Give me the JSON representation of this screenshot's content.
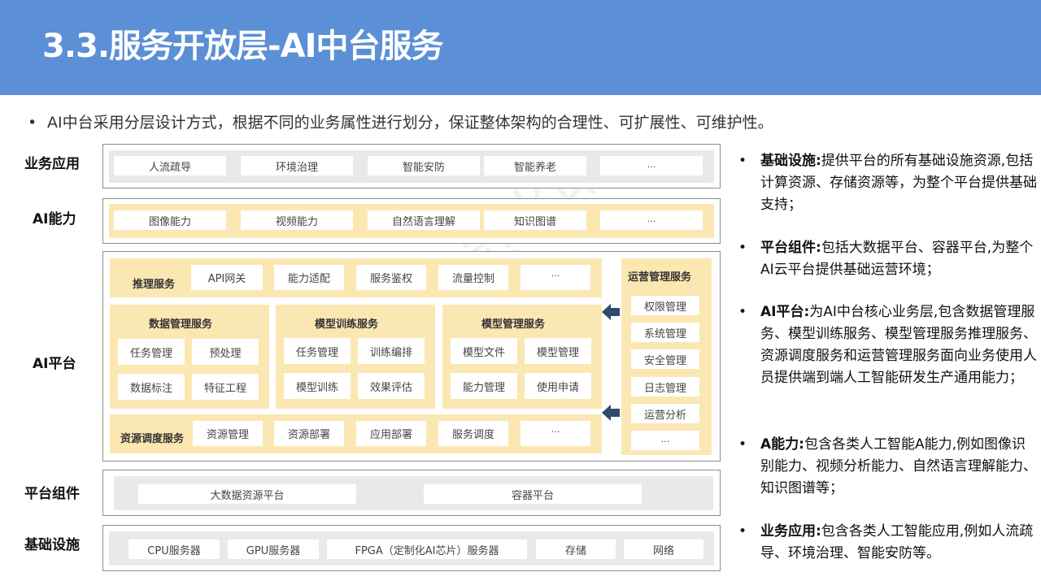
{
  "title": "3.3.服务开放层-AI中台服务",
  "intro": "AI中台采用分层设计方式，根据不同的业务属性进行划分，保证整体架构的合理性、可扩展性、可维护性。",
  "bullet": "•",
  "layers": {
    "business": {
      "label": "业务应用",
      "items": [
        "人流疏导",
        "环境治理",
        "智能安防",
        "智能养老",
        "…"
      ]
    },
    "ability": {
      "label": "AI能力",
      "items": [
        "图像能力",
        "视频能力",
        "自然语言理解",
        "知识图谱",
        "…"
      ]
    },
    "platform": {
      "label": "AI平台",
      "inference": {
        "title": "推理服务",
        "items": [
          "API网关",
          "能力适配",
          "服务鉴权",
          "流量控制",
          "…"
        ]
      },
      "data_mgmt": {
        "title": "数据管理服务",
        "items": [
          "任务管理",
          "预处理",
          "数据标注",
          "特征工程"
        ]
      },
      "training": {
        "title": "模型训练服务",
        "items": [
          "任务管理",
          "训练编排",
          "模型训练",
          "效果评估"
        ]
      },
      "model_mgmt": {
        "title": "模型管理服务",
        "items": [
          "模型文件",
          "模型管理",
          "能力管理",
          "使用申请"
        ]
      },
      "scheduling": {
        "title": "资源调度服务",
        "items": [
          "资源管理",
          "资源部署",
          "应用部署",
          "服务调度",
          "…"
        ]
      },
      "operations": {
        "title": "运营管理服务",
        "items": [
          "权限管理",
          "系统管理",
          "安全管理",
          "日志管理",
          "运营分析",
          "…"
        ]
      }
    },
    "components": {
      "label": "平台组件",
      "items": [
        "大数据资源平台",
        "容器平台"
      ]
    },
    "infrastructure": {
      "label": "基础设施",
      "items": [
        "CPU服务器",
        "GPU服务器",
        "FPGA（定制化AI芯片）服务器",
        "存储",
        "网络"
      ]
    }
  },
  "descriptions": [
    {
      "term": "基础设施:",
      "text": "提供平台的所有基础设施资源,包括计算资源、存储资源等，为整个平台提供基础支持；"
    },
    {
      "term": "平台组件:",
      "text": "包括大数据平台、容器平台,为整个AI云平台提供基础运营环境；"
    },
    {
      "term": "AI平台:",
      "text": "为AI中台核心业务层,包含数据管理服务、模型训练服务、模型管理服务推理服务、资源调度服务和运营管理服务面向业务使用人员提供端到端人工智能研发生产通用能力；"
    },
    {
      "term": "A能力:",
      "text": "包含各类人工智能A能力,例如图像识别能力、视频分析能力、自然语言理解能力、知识图谱等；"
    },
    {
      "term": "业务应用:",
      "text": "包含各类人工智能应用,例如人流疏导、环境治理、智能安防等。"
    }
  ],
  "colors": {
    "header": "#5b8fd6",
    "service_band": "#fbe7b2",
    "gray_band": "#e9e9e9",
    "arrow": "#2f4a6b"
  }
}
